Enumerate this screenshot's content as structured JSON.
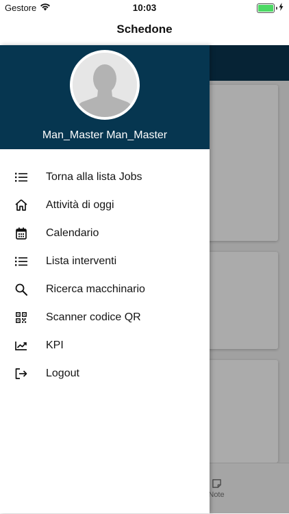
{
  "status_bar": {
    "carrier": "Gestore",
    "time": "10:03",
    "battery_color": "#4cd964"
  },
  "nav": {
    "title": "Schedone"
  },
  "drawer": {
    "header_color": "#063650",
    "user_name": "Man_Master Man_Master",
    "menu": [
      {
        "label": "Torna alla lista Jobs",
        "icon": "list-icon"
      },
      {
        "label": "Attività di oggi",
        "icon": "home-icon"
      },
      {
        "label": "Calendario",
        "icon": "calendar-icon"
      },
      {
        "label": "Lista interventi",
        "icon": "list-icon"
      },
      {
        "label": "Ricerca macchinario",
        "icon": "search-icon"
      },
      {
        "label": "Scanner codice QR",
        "icon": "qr-code-icon"
      },
      {
        "label": "KPI",
        "icon": "trending-up-icon"
      },
      {
        "label": "Logout",
        "icon": "logout-icon"
      }
    ]
  },
  "background": {
    "bottom_tab_label": "Note",
    "bottom_tab_icon": "note-icon"
  }
}
